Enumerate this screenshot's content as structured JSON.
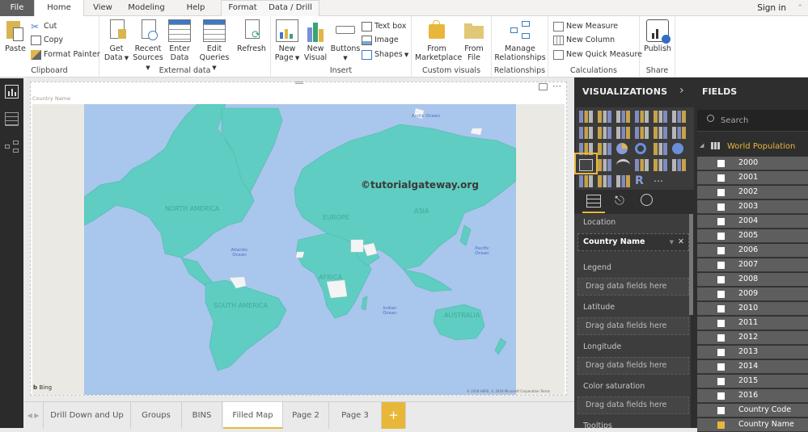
{
  "ribbon_tabs": [
    {
      "label": "File"
    },
    {
      "label": "Home",
      "active": true
    },
    {
      "label": "View"
    },
    {
      "label": "Modeling"
    },
    {
      "label": "Help"
    },
    {
      "label": "Format"
    },
    {
      "label": "Data / Drill"
    }
  ],
  "sign_in": "Sign in",
  "ribbon": {
    "clipboard": {
      "label": "Clipboard",
      "paste": "Paste",
      "cut": "Cut",
      "copy": "Copy",
      "format_painter": "Format Painter"
    },
    "external_data": {
      "label": "External data",
      "get_data": [
        "Get",
        "Data"
      ],
      "recent_sources": [
        "Recent",
        "Sources"
      ],
      "enter_data": [
        "Enter",
        "Data"
      ],
      "edit_queries": [
        "Edit",
        "Queries"
      ],
      "refresh": "Refresh"
    },
    "insert": {
      "label": "Insert",
      "new_page": [
        "New",
        "Page"
      ],
      "new_visual": [
        "New",
        "Visual"
      ],
      "buttons": "Buttons",
      "text_box": "Text box",
      "image": "Image",
      "shapes": "Shapes"
    },
    "custom_visuals": {
      "label": "Custom visuals",
      "from_marketplace": [
        "From",
        "Marketplace"
      ],
      "from_file": [
        "From",
        "File"
      ]
    },
    "relationships": {
      "label": "Relationships",
      "manage": [
        "Manage",
        "Relationships"
      ]
    },
    "calculations": {
      "label": "Calculations",
      "new_measure": "New Measure",
      "new_column": "New Column",
      "new_quick_measure": "New Quick Measure"
    },
    "share": {
      "label": "Share",
      "publish": "Publish"
    }
  },
  "visual": {
    "title": "Country Name",
    "watermark": "©tutorialgateway.org",
    "continents": [
      "NORTH AMERICA",
      "SOUTH AMERICA",
      "EUROPE",
      "AFRICA",
      "ASIA",
      "AUSTRALIA"
    ],
    "oceans": [
      "Arctic Ocean",
      "Atlantic Ocean",
      "Pacific Ocean",
      "Indian Ocean"
    ],
    "bing": "Bing",
    "copyright": "© 2018 HERE, © 2018 Microsoft Corporation  Terms",
    "colors": {
      "land": "#5fcdc1",
      "water": "#a9c6ec",
      "no_data": "#f4f4f4"
    }
  },
  "page_tabs": [
    {
      "label": "Drill Down and Up"
    },
    {
      "label": "Groups"
    },
    {
      "label": "BINS"
    },
    {
      "label": "Filled Map",
      "active": true
    },
    {
      "label": "Page 2"
    },
    {
      "label": "Page 3"
    }
  ],
  "add_page": "+",
  "visualizations": {
    "title": "VISUALIZATIONS",
    "selected": "filled-map",
    "wells": {
      "location": {
        "label": "Location",
        "value": "Country Name"
      },
      "legend": {
        "label": "Legend",
        "placeholder": "Drag data fields here"
      },
      "latitude": {
        "label": "Latitude",
        "placeholder": "Drag data fields here"
      },
      "longitude": {
        "label": "Longitude",
        "placeholder": "Drag data fields here"
      },
      "color_saturation": {
        "label": "Color saturation",
        "placeholder": "Drag data fields here"
      },
      "tooltips": {
        "label": "Tooltips"
      }
    }
  },
  "fields": {
    "title": "FIELDS",
    "search_placeholder": "Search",
    "table": "World Population",
    "items": [
      {
        "label": "2000",
        "checked": false
      },
      {
        "label": "2001",
        "checked": false
      },
      {
        "label": "2002",
        "checked": false
      },
      {
        "label": "2003",
        "checked": false
      },
      {
        "label": "2004",
        "checked": false
      },
      {
        "label": "2005",
        "checked": false
      },
      {
        "label": "2006",
        "checked": false
      },
      {
        "label": "2007",
        "checked": false
      },
      {
        "label": "2008",
        "checked": false
      },
      {
        "label": "2009",
        "checked": false
      },
      {
        "label": "2010",
        "checked": false
      },
      {
        "label": "2011",
        "checked": false
      },
      {
        "label": "2012",
        "checked": false
      },
      {
        "label": "2013",
        "checked": false
      },
      {
        "label": "2014",
        "checked": false
      },
      {
        "label": "2015",
        "checked": false
      },
      {
        "label": "2016",
        "checked": false
      },
      {
        "label": "Country Code",
        "checked": false
      },
      {
        "label": "Country Name",
        "checked": true
      }
    ]
  },
  "accent_color": "#e8b73a"
}
